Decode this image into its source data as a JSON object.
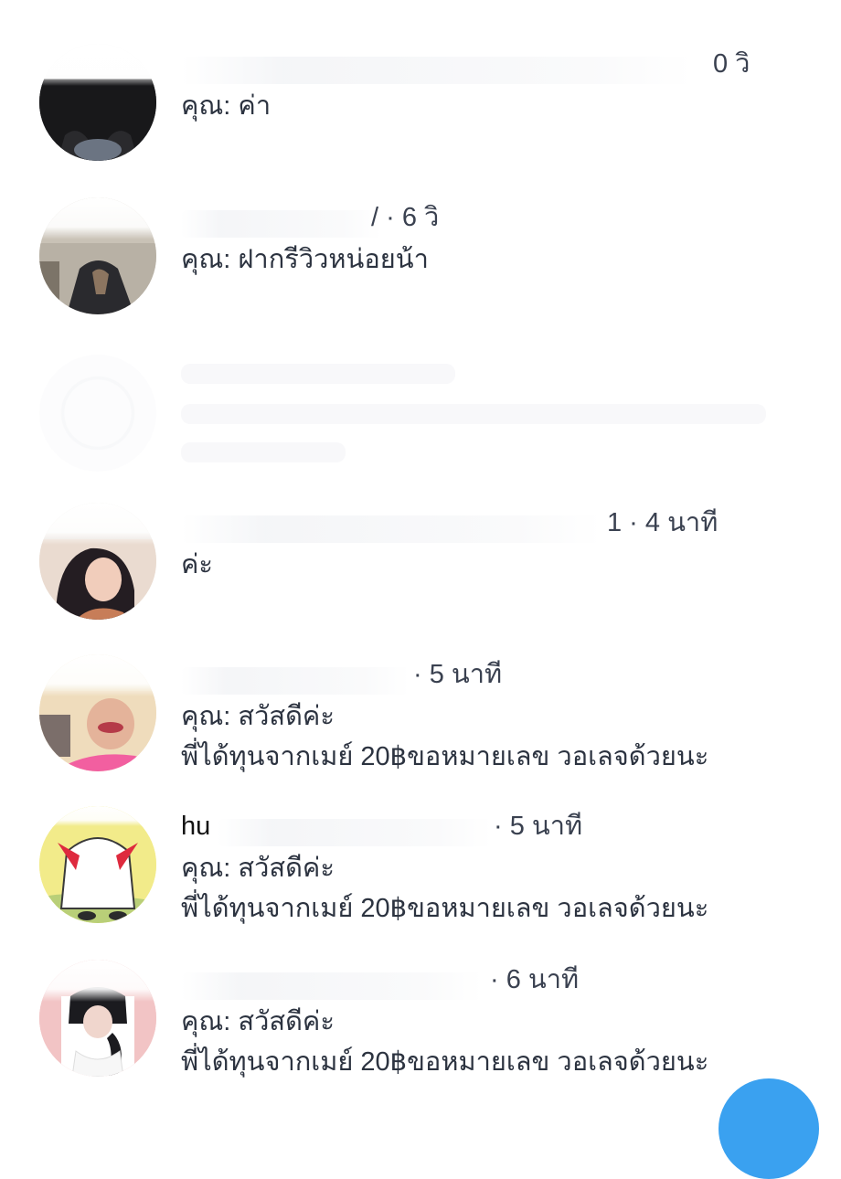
{
  "threads": [
    {
      "name": "",
      "time": "0 วิ",
      "line1": "คุณ: ค่า",
      "line2": "",
      "avatar_colors": [
        "#2a2a2c",
        "#131315",
        "#5c6574"
      ]
    },
    {
      "name": "",
      "time": "/ · 6 วิ",
      "line1": "คุณ: ฝากรีวิวหน่อยน้า",
      "line2": "",
      "avatar_colors": [
        "#b8b1a5",
        "#2c2c30",
        "#8c7560"
      ]
    },
    {
      "name": "",
      "time": "1 · 4 นาที",
      "line1": "ค่ะ",
      "line2": "",
      "avatar_colors": [
        "#e9d7cc",
        "#2a2227",
        "#c77d58"
      ]
    },
    {
      "name": "",
      "time": "· 5 นาที",
      "line1": "คุณ: สวัสดีค่ะ",
      "line2": "พี่ได้ทุนจากเมย์ 20฿ขอหมายเลข วอเลจด้วยนะ",
      "avatar_colors": [
        "#f3e0b8",
        "#f25fa0",
        "#d8a086"
      ]
    },
    {
      "name": "hu",
      "time": "· 5 นาที",
      "line1": "คุณ: สวัสดีค่ะ",
      "line2": "พี่ได้ทุนจากเมย์ 20฿ขอหมายเลข วอเลจด้วยนะ",
      "avatar_colors": [
        "#f4ee8f",
        "#ffffff",
        "#de2a3e"
      ]
    },
    {
      "name": "",
      "time": "· 6 นาที",
      "line1": "คุณ: สวัสดีค่ะ",
      "line2": "พี่ได้ทุนจากเมย์ 20฿ขอหมายเลข วอเลจด้วยนะ",
      "avatar_colors": [
        "#f2c3c4",
        "#ffffff",
        "#1b1b1f"
      ]
    }
  ],
  "accent": "#3aa1f0"
}
